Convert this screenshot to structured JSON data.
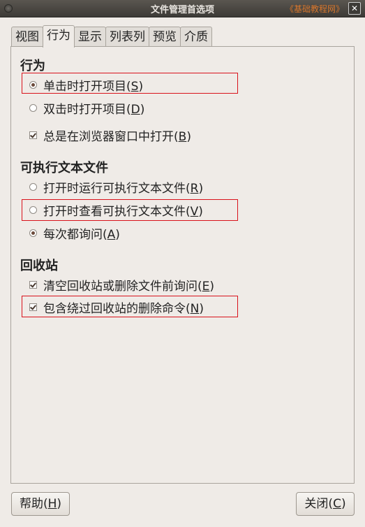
{
  "window": {
    "title": "文件管理首选项",
    "watermark": "《基础教程网》",
    "close_symbol": "✕"
  },
  "tabs": [
    "视图",
    "行为",
    "显示",
    "列表列",
    "预览",
    "介质"
  ],
  "active_tab": "行为",
  "sections": {
    "behavior": {
      "title": "行为",
      "options": [
        {
          "text": "单击时打开项目(",
          "key": "S",
          "tail": ")",
          "type": "radio",
          "checked": true
        },
        {
          "text": "双击时打开项目(",
          "key": "D",
          "tail": ")",
          "type": "radio",
          "checked": false
        },
        {
          "text": "总是在浏览器窗口中打开(",
          "key": "B",
          "tail": ")",
          "type": "checkbox",
          "checked": true
        }
      ]
    },
    "executable": {
      "title": "可执行文本文件",
      "options": [
        {
          "text": "打开时运行可执行文本文件(",
          "key": "R",
          "tail": ")",
          "type": "radio",
          "checked": false
        },
        {
          "text": "打开时查看可执行文本文件(",
          "key": "V",
          "tail": ")",
          "type": "radio",
          "checked": false
        },
        {
          "text": "每次都询问(",
          "key": "A",
          "tail": ")",
          "type": "radio",
          "checked": true
        }
      ]
    },
    "trash": {
      "title": "回收站",
      "options": [
        {
          "text": "清空回收站或删除文件前询问(",
          "key": "E",
          "tail": ")",
          "type": "checkbox",
          "checked": true
        },
        {
          "text": "包含绕过回收站的删除命令(",
          "key": "N",
          "tail": ")",
          "type": "checkbox",
          "checked": true
        }
      ]
    }
  },
  "buttons": {
    "help": {
      "text": "帮助(",
      "key": "H",
      "tail": ")"
    },
    "close": {
      "text": "关闭(",
      "key": "C",
      "tail": ")"
    }
  },
  "colors": {
    "highlight_box": "#d9121b",
    "watermark": "#d8762c"
  }
}
